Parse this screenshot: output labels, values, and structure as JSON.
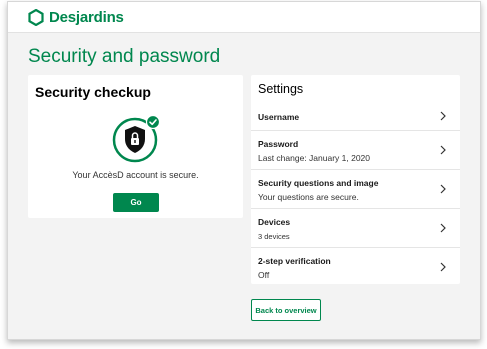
{
  "brand": {
    "name": "Desjardins",
    "color": "#00874e"
  },
  "page": {
    "title": "Security and password"
  },
  "checkup": {
    "title": "Security checkup",
    "icon": "shield-lock-icon",
    "status_icon": "check-badge-icon",
    "message": "Your AccèsD account is secure.",
    "button_label": "Go"
  },
  "settings": {
    "title": "Settings",
    "items": [
      {
        "label": "Username",
        "sub": ""
      },
      {
        "label": "Password",
        "sub": "Last change: January 1, 2020"
      },
      {
        "label": "Security questions and image",
        "sub": "Your questions are secure."
      },
      {
        "label": "Devices",
        "sub": "3 devices"
      },
      {
        "label": "2-step verification",
        "sub": "Off"
      }
    ],
    "chevron_icon": "chevron-right-icon"
  },
  "footer": {
    "back_label": "Back to overview"
  }
}
